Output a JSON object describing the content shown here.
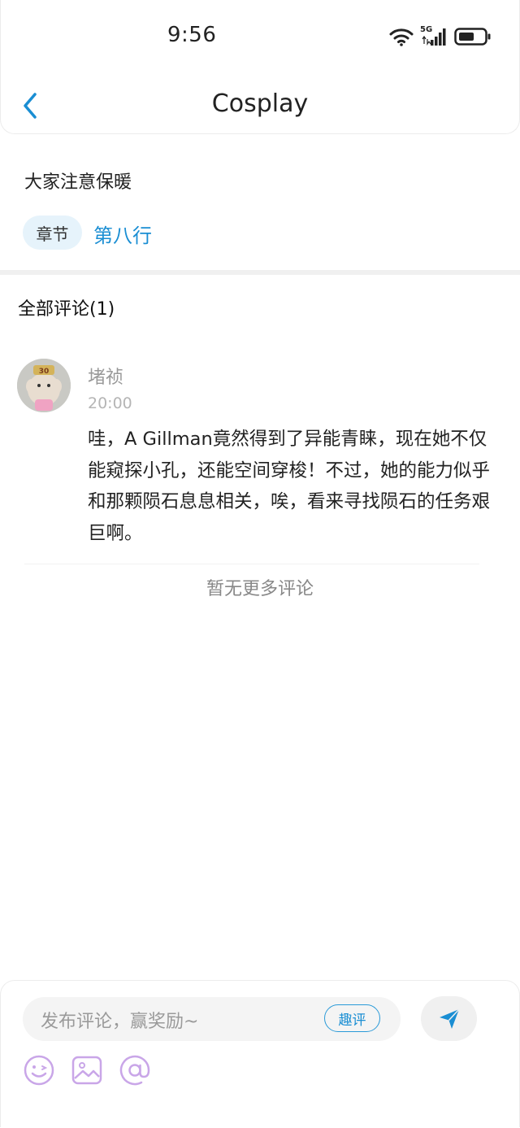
{
  "status_bar": {
    "time": "9:56",
    "network": "5G",
    "icons": [
      "wifi-icon",
      "signal-icon",
      "battery-icon"
    ]
  },
  "nav": {
    "title": "Cosplay",
    "back_icon": "chevron-left-icon"
  },
  "post": {
    "text": "大家注意保暖",
    "chapter_tag": "章节",
    "chapter_name": "第八行"
  },
  "comments": {
    "title": "全部评论(1)",
    "items": [
      {
        "user": "堵祯",
        "time": "20:00",
        "text": "哇，A Gillman竟然得到了异能青睐，现在她不仅能窥探小孔，还能空间穿梭！不过，她的能力似乎和那颗陨石息息相关，唉，看来寻找陨石的任务艰巨啊。",
        "avatar_badge": "30"
      }
    ],
    "no_more": "暂无更多评论"
  },
  "input_bar": {
    "placeholder": "发布评论，赢奖励~",
    "fun_comment_label": "趣评",
    "send_icon": "send-icon",
    "tools": [
      "emoji-icon",
      "image-icon",
      "at-icon"
    ]
  },
  "colors": {
    "accent": "#1a8ed3",
    "tag_bg": "#e6f3fb",
    "tool_icon": "#c9a6e8"
  }
}
